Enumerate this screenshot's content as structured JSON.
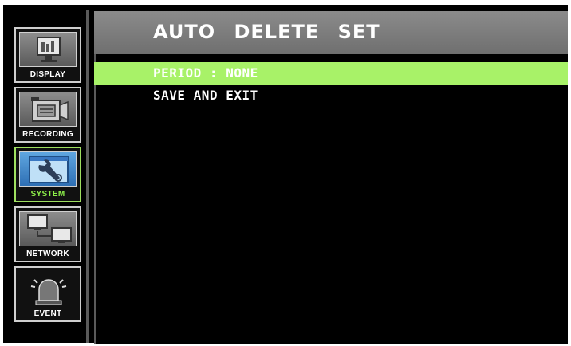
{
  "colors": {
    "background": "#000000",
    "titlebar": "#7d7d7d",
    "selection": "#a8f268",
    "active_nav": "#9fe060"
  },
  "sidebar": {
    "items": [
      {
        "label": "DISPLAY",
        "icon": "display-icon",
        "active": false
      },
      {
        "label": "RECORDING",
        "icon": "camera-icon",
        "active": false
      },
      {
        "label": "SYSTEM",
        "icon": "wrench-icon",
        "active": true
      },
      {
        "label": "NETWORK",
        "icon": "network-icon",
        "active": false
      },
      {
        "label": "EVENT",
        "icon": "alarm-icon",
        "active": false
      }
    ]
  },
  "main": {
    "title": "AUTO DELETE SET",
    "menu": [
      {
        "label": "PERIOD : NONE",
        "selected": true
      },
      {
        "label": "SAVE AND EXIT",
        "selected": false
      }
    ]
  }
}
